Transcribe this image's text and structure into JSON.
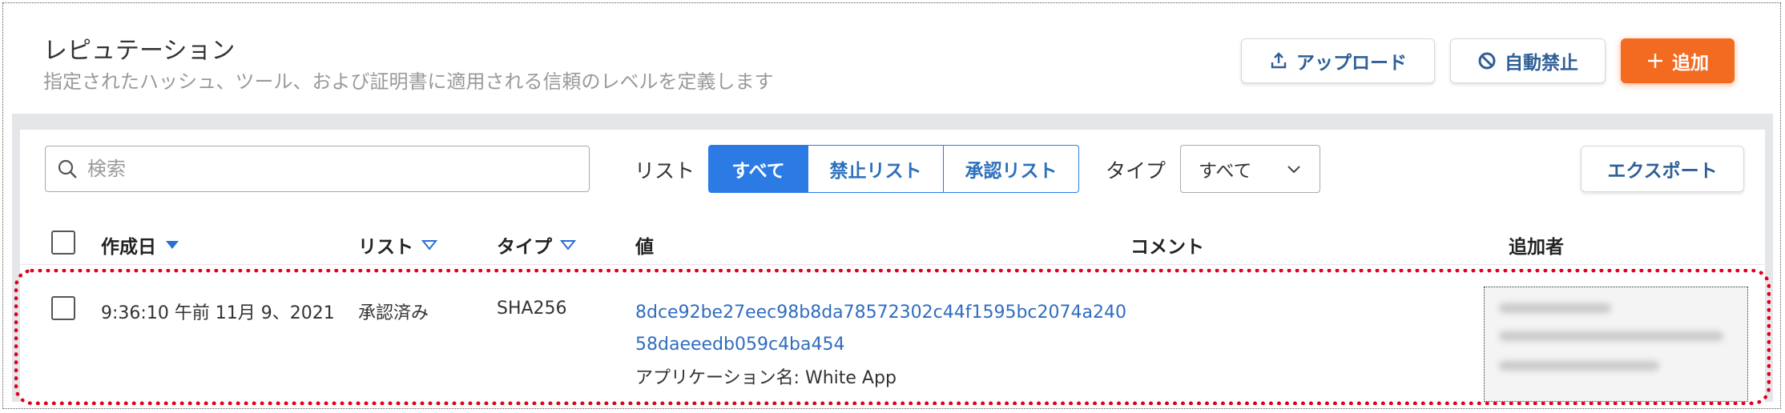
{
  "header": {
    "title": "レピュテーション",
    "subtitle": "指定されたハッシュ、ツール、および証明書に適用される信頼のレベルを定義します",
    "upload_label": "アップロード",
    "ban_label": "自動禁止",
    "add_label": "追加"
  },
  "toolbar": {
    "search_placeholder": "検索",
    "list_label": "リスト",
    "list_segments": [
      "すべて",
      "禁止リスト",
      "承認リスト"
    ],
    "list_selected": "すべて",
    "type_label": "タイプ",
    "type_selected": "すべて",
    "export_label": "エクスポート"
  },
  "table": {
    "columns": [
      "作成日",
      "リスト",
      "タイプ",
      "値",
      "コメント",
      "追加者"
    ],
    "rows": [
      {
        "created": "9:36:10 午前 11月 9、2021",
        "list": "承認済み",
        "type": "SHA256",
        "value_line1": "8dce92be27eec98b8da78572302c44f1595bc2074a240",
        "value_line2": "58daeeedb059c4ba454",
        "app_name": "アプリケーション名: White App",
        "comment": "",
        "added_by": ""
      }
    ]
  },
  "colors": {
    "accent": "#2c7be5",
    "add_button": "#f36a21",
    "highlight_border": "#e0001b",
    "link": "#2f6dbf"
  }
}
